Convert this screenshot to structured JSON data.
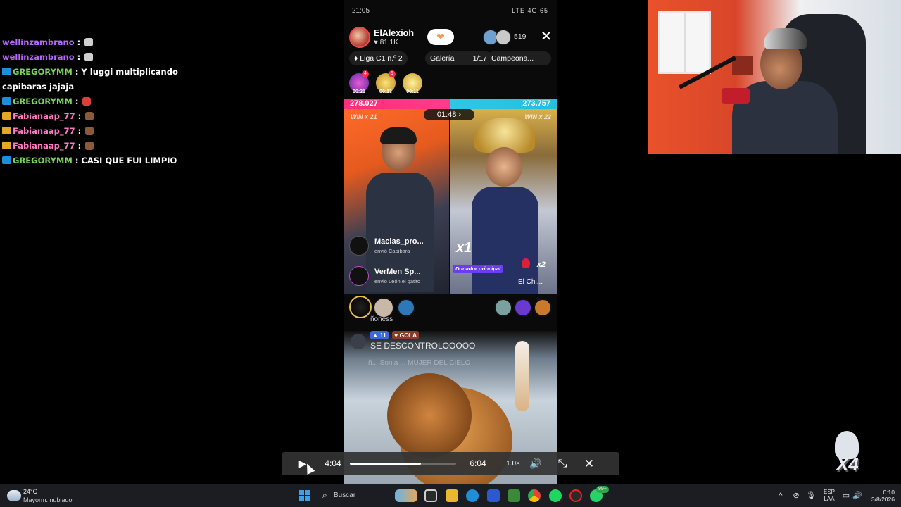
{
  "chat": [
    {
      "user": "wellinzambrano",
      "msg": "",
      "color": "#b866ff",
      "badge": "",
      "emote": "#cfcfcf"
    },
    {
      "user": "wellinzambrano",
      "msg": "",
      "color": "#b866ff",
      "badge": "",
      "emote": "#cfcfcf"
    },
    {
      "user": "GREGORYMM",
      "msg": "Y luggi multiplicando capibaras jajaja",
      "color": "#7cd65a",
      "badge": "blue",
      "emote": ""
    },
    {
      "user": "GREGORYMM",
      "msg": "",
      "color": "#7cd65a",
      "badge": "blue",
      "emote": "#d8423a"
    },
    {
      "user": "Fabianaap_77",
      "msg": "",
      "color": "#ff7ac3",
      "badge": "gold",
      "emote": "#8a5a3a"
    },
    {
      "user": "Fabianaap_77",
      "msg": "",
      "color": "#ff7ac3",
      "badge": "gold",
      "emote": "#8a5a3a"
    },
    {
      "user": "Fabianaap_77",
      "msg": "",
      "color": "#ff7ac3",
      "badge": "gold",
      "emote": "#8a5a3a"
    },
    {
      "user": "GREGORYMM",
      "msg": "CASI QUE FUI LIMPIO",
      "color": "#7cd65a",
      "badge": "blue",
      "emote": ""
    }
  ],
  "chat_separator": " : ",
  "phone": {
    "status_time": "21:05",
    "status_icons": "LTE 4G 65",
    "host": {
      "name": "ElAlexioh",
      "likes": "81.1K"
    },
    "viewer_count": "519",
    "pills": {
      "league": "Liga C1 n.º 2",
      "gallery": "Galería",
      "gallery_count": "1/17",
      "campaign": "Campeona..."
    },
    "gift_badges": [
      {
        "time": "00:21",
        "dot": "4",
        "color": "#b04ad8"
      },
      {
        "time": "00:13",
        "dot": "5",
        "color": "#e8c23a"
      },
      {
        "time": "00:11",
        "dot": "",
        "color": "#f0cf4a"
      }
    ],
    "battle": {
      "score_left": "278.027",
      "score_right": "273.757",
      "timer": "01:48",
      "win_left": "WIN x 21",
      "win_right": "WIN x 22"
    },
    "donors": [
      {
        "name": "Macias_pro...",
        "sub": "envió Capibara"
      },
      {
        "name": "VerMen Sp...",
        "sub": "envió León el gatito"
      }
    ],
    "right_cam": {
      "multiplier": "x1",
      "donor_label": "Donador principal",
      "gift_count": "x2",
      "name": "El Chi..."
    },
    "comment": {
      "top_text": "ñoness",
      "level": "11",
      "tag": "GOLA",
      "text": "SE DESCONTROLOOOOO",
      "faded": "ñ... Sonia ... MUJER DEL CIELO"
    }
  },
  "controls": {
    "current_time": "4:04",
    "total_time": "6:04",
    "speed": "1.0×",
    "progress": 0.67
  },
  "overlay_x4": "X4",
  "taskbar": {
    "temp": "24°C",
    "weather": "Mayorm. nublado",
    "search_placeholder": "Buscar",
    "lang_top": "ESP",
    "lang_bottom": "LAA",
    "time": "0:10",
    "date": "3/8/2026",
    "notif_badge": "99+"
  }
}
